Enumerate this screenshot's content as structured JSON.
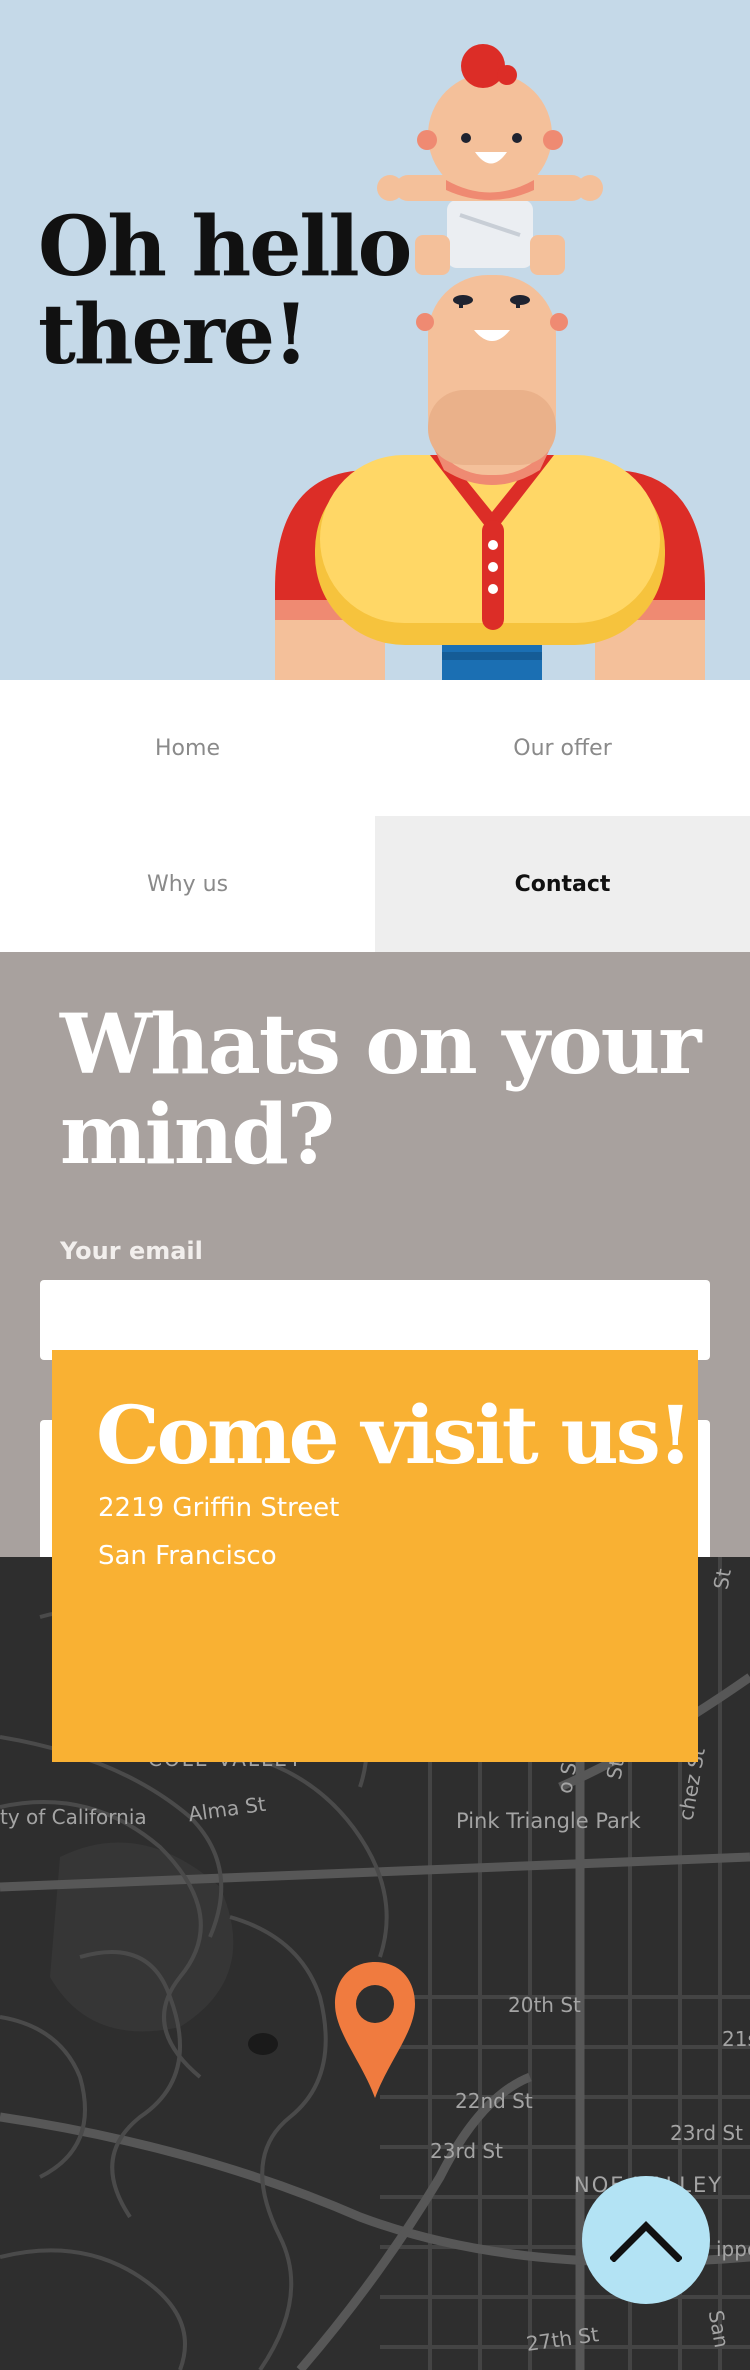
{
  "hero": {
    "title_line1": "Oh hello",
    "title_line2": "there!",
    "illustration": "father-with-baby-on-head"
  },
  "nav": {
    "items": [
      {
        "label": "Home"
      },
      {
        "label": "Our offer"
      },
      {
        "label": "Why us"
      },
      {
        "label": "Contact",
        "active": true
      }
    ]
  },
  "contact_form": {
    "title_line1": "Whats on your",
    "title_line2": "mind?",
    "email_label": "Your email",
    "email_value": "",
    "message_value": ""
  },
  "visit": {
    "title": "Come visit us!",
    "address_line1": "2219  Griffin Street",
    "address_line2": "San Francisco"
  },
  "map": {
    "labels": [
      "St",
      "COLE VALLEY",
      "o St",
      "St",
      "chez St",
      "ty of California",
      "Alma St",
      "Pink Triangle Park",
      "20th St",
      "21s",
      "22nd St",
      "23rd St",
      "23rd St",
      "NOE VALLEY",
      "ippe",
      "27th St",
      "San"
    ],
    "pin_icon": "location-pin-icon"
  },
  "scroll_top": {
    "icon": "chevron-up-icon"
  },
  "colors": {
    "hero_bg": "#c5d9e8",
    "form_bg": "#a8a19e",
    "visit_bg": "#f9b133",
    "map_bg": "#2e2e2e",
    "pin": "#f07b3f",
    "scroll_top_bg": "#b3e3f4"
  }
}
